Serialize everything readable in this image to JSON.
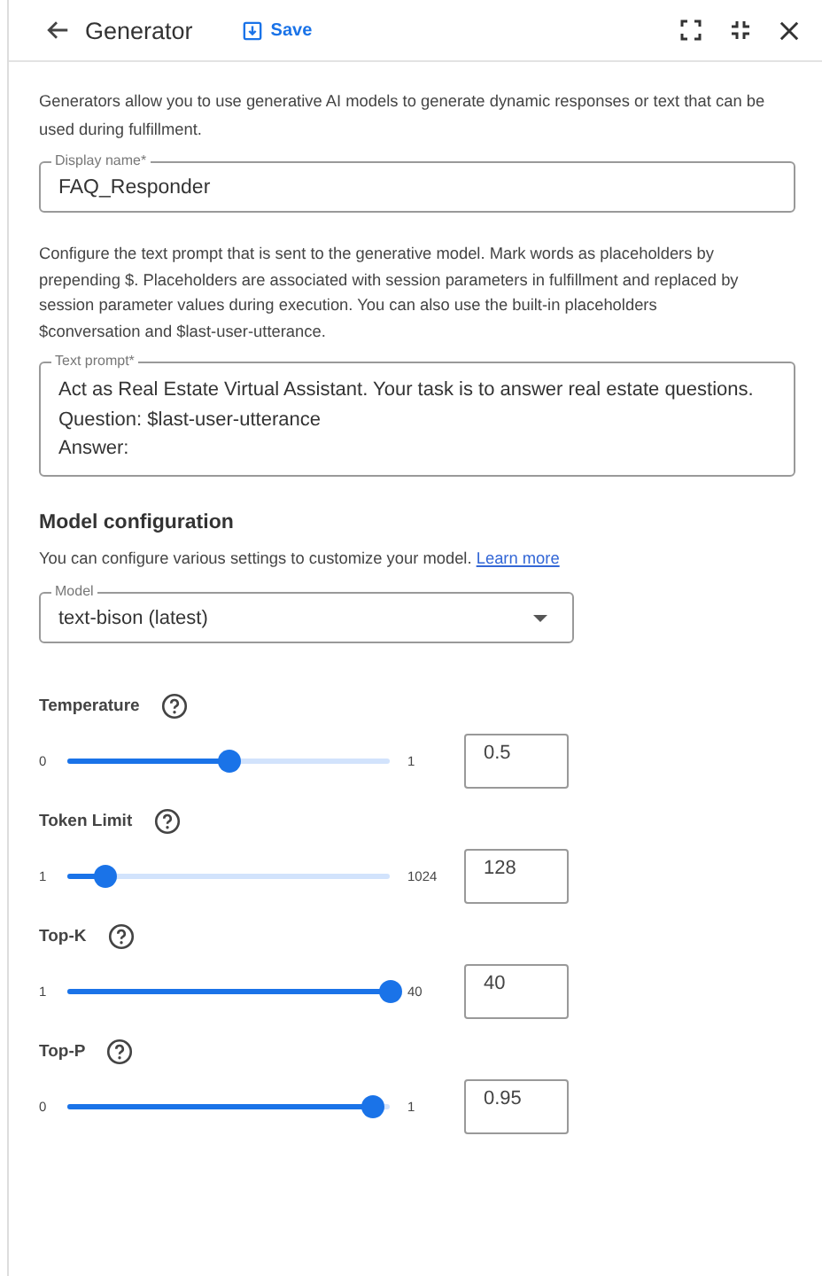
{
  "header": {
    "title": "Generator",
    "save": "Save"
  },
  "intro": "Generators allow you to use generative AI models to generate dynamic responses or text that can be used during fulfillment.",
  "display_name": {
    "label": "Display name*",
    "value": "FAQ_Responder"
  },
  "prompt_help": "Configure the text prompt that is sent to the generative model. Mark words as placeholders by prepending $. Placeholders are associated with session parameters in fulfillment and replaced by session parameter values during execution. You can also use the built-in placeholders $conversation and $last-user-utterance.",
  "text_prompt": {
    "label": "Text prompt*",
    "lines": [
      "Act as Real Estate Virtual Assistant. Your task is to answer real estate questions.",
      "Question: $last-user-utterance",
      "Answer:"
    ]
  },
  "model_config": {
    "heading": "Model configuration",
    "text": "You can configure various settings to customize your model.",
    "link": "Learn more",
    "model": {
      "label": "Model",
      "value": "text-bison (latest)"
    }
  },
  "params": [
    {
      "name": "Temperature",
      "min": "0",
      "max": "1",
      "level": 0.5,
      "value": "0.5"
    },
    {
      "name": "Token Limit",
      "min": "1",
      "max": "1024",
      "level": 0.12,
      "value": "128"
    },
    {
      "name": "Top-K",
      "min": "1",
      "max": "40",
      "level": 1.0,
      "value": "40"
    },
    {
      "name": "Top-P",
      "min": "0",
      "max": "1",
      "level": 0.95,
      "value": "0.95"
    }
  ]
}
